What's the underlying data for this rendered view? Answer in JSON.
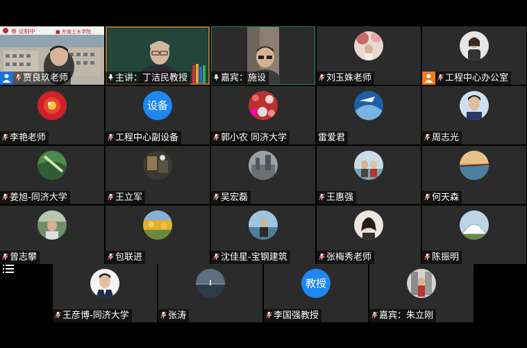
{
  "participants": {
    "row1": [
      {
        "name": "贾良玖老师",
        "avatar": "school-video",
        "badge": "host"
      },
      {
        "name": "主讲：丁洁民教授",
        "avatar": "speaker-video"
      },
      {
        "name": "嘉宾：施设",
        "avatar": "guest-video"
      },
      {
        "name": "刘玉姝老师",
        "avatar": "photo"
      },
      {
        "name": "工程中心办公室",
        "avatar": "photo",
        "badge": "host"
      }
    ],
    "row2": [
      {
        "name": "李艳老师",
        "avatar": "photo"
      },
      {
        "name": "工程中心副设备",
        "avatar_text": "设备"
      },
      {
        "name": "郭小农 同济大学",
        "avatar": "photo"
      },
      {
        "name": "雷爱君",
        "avatar": "photo"
      },
      {
        "name": "周志光",
        "avatar": "photo"
      }
    ],
    "row3": [
      {
        "name": "姜旭-同济大学",
        "avatar": "photo"
      },
      {
        "name": "王立军",
        "avatar": "photo"
      },
      {
        "name": "吴宏磊",
        "avatar": "photo"
      },
      {
        "name": "王惠强",
        "avatar": "photo"
      },
      {
        "name": "何天森",
        "avatar": "photo"
      }
    ],
    "row4": [
      {
        "name": "曾志攀",
        "avatar": "photo"
      },
      {
        "name": "包联进",
        "avatar": "photo"
      },
      {
        "name": "沈佳星-宝钢建筑",
        "avatar": "photo"
      },
      {
        "name": "张梅秀老师",
        "avatar": "photo"
      },
      {
        "name": "陈振明",
        "avatar": "photo"
      }
    ],
    "row5": [
      {
        "name": "王彦博-同济大学",
        "avatar": "photo"
      },
      {
        "name": "张涛",
        "avatar": "photo"
      },
      {
        "name": "李国强教授",
        "avatar_text": "教授"
      },
      {
        "name": "嘉宾：朱立刚",
        "avatar": "photo"
      }
    ]
  },
  "colors": {
    "avatar_text_bg": "#1e87f0",
    "tile_bg": "#2b2b2b",
    "active_speaker": "#a8742a",
    "mic_muted": "#e0453a"
  }
}
